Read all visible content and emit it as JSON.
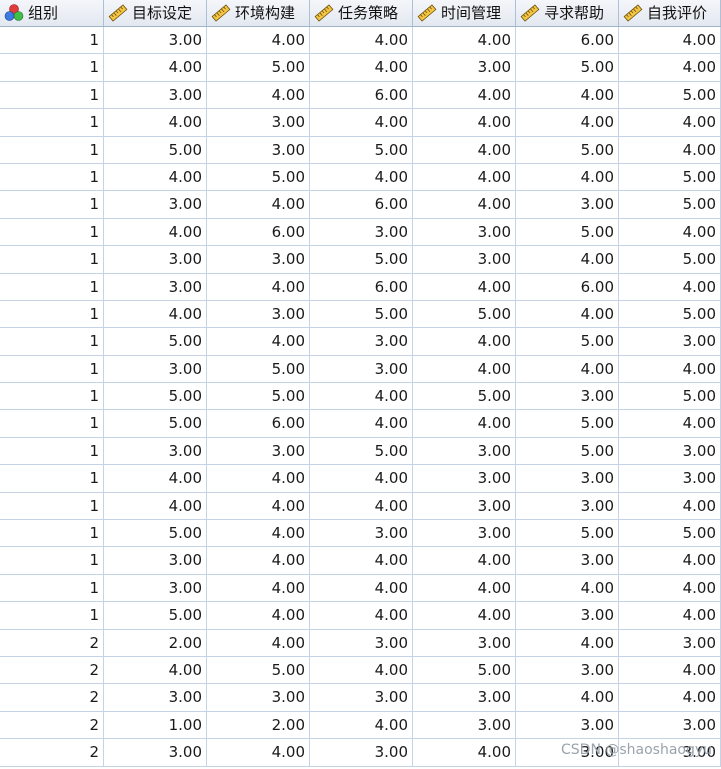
{
  "columns": [
    {
      "label": "组别",
      "icon": "nominal-icon"
    },
    {
      "label": "目标设定",
      "icon": "scale-ruler-icon"
    },
    {
      "label": "环境构建",
      "icon": "scale-ruler-icon"
    },
    {
      "label": "任务策略",
      "icon": "scale-ruler-icon"
    },
    {
      "label": "时间管理",
      "icon": "scale-ruler-icon"
    },
    {
      "label": "寻求帮助",
      "icon": "scale-ruler-icon"
    },
    {
      "label": "自我评价",
      "icon": "scale-ruler-icon"
    }
  ],
  "rows": [
    [
      "1",
      "3.00",
      "4.00",
      "4.00",
      "4.00",
      "6.00",
      "4.00"
    ],
    [
      "1",
      "4.00",
      "5.00",
      "4.00",
      "3.00",
      "5.00",
      "4.00"
    ],
    [
      "1",
      "3.00",
      "4.00",
      "6.00",
      "4.00",
      "4.00",
      "5.00"
    ],
    [
      "1",
      "4.00",
      "3.00",
      "4.00",
      "4.00",
      "4.00",
      "4.00"
    ],
    [
      "1",
      "5.00",
      "3.00",
      "5.00",
      "4.00",
      "5.00",
      "4.00"
    ],
    [
      "1",
      "4.00",
      "5.00",
      "4.00",
      "4.00",
      "4.00",
      "5.00"
    ],
    [
      "1",
      "3.00",
      "4.00",
      "6.00",
      "4.00",
      "3.00",
      "5.00"
    ],
    [
      "1",
      "4.00",
      "6.00",
      "3.00",
      "3.00",
      "5.00",
      "4.00"
    ],
    [
      "1",
      "3.00",
      "3.00",
      "5.00",
      "3.00",
      "4.00",
      "5.00"
    ],
    [
      "1",
      "3.00",
      "4.00",
      "6.00",
      "4.00",
      "6.00",
      "4.00"
    ],
    [
      "1",
      "4.00",
      "3.00",
      "5.00",
      "5.00",
      "4.00",
      "5.00"
    ],
    [
      "1",
      "5.00",
      "4.00",
      "3.00",
      "4.00",
      "5.00",
      "3.00"
    ],
    [
      "1",
      "3.00",
      "5.00",
      "3.00",
      "4.00",
      "4.00",
      "4.00"
    ],
    [
      "1",
      "5.00",
      "5.00",
      "4.00",
      "5.00",
      "3.00",
      "5.00"
    ],
    [
      "1",
      "5.00",
      "6.00",
      "4.00",
      "4.00",
      "5.00",
      "4.00"
    ],
    [
      "1",
      "3.00",
      "3.00",
      "5.00",
      "3.00",
      "5.00",
      "3.00"
    ],
    [
      "1",
      "4.00",
      "4.00",
      "4.00",
      "3.00",
      "3.00",
      "3.00"
    ],
    [
      "1",
      "4.00",
      "4.00",
      "4.00",
      "3.00",
      "3.00",
      "4.00"
    ],
    [
      "1",
      "5.00",
      "4.00",
      "3.00",
      "3.00",
      "5.00",
      "5.00"
    ],
    [
      "1",
      "3.00",
      "4.00",
      "4.00",
      "4.00",
      "3.00",
      "4.00"
    ],
    [
      "1",
      "3.00",
      "4.00",
      "4.00",
      "4.00",
      "4.00",
      "4.00"
    ],
    [
      "1",
      "5.00",
      "4.00",
      "4.00",
      "4.00",
      "3.00",
      "4.00"
    ],
    [
      "2",
      "2.00",
      "4.00",
      "3.00",
      "3.00",
      "4.00",
      "3.00"
    ],
    [
      "2",
      "4.00",
      "5.00",
      "4.00",
      "5.00",
      "3.00",
      "4.00"
    ],
    [
      "2",
      "3.00",
      "3.00",
      "3.00",
      "3.00",
      "4.00",
      "4.00"
    ],
    [
      "2",
      "1.00",
      "2.00",
      "4.00",
      "3.00",
      "3.00",
      "3.00"
    ],
    [
      "2",
      "3.00",
      "4.00",
      "3.00",
      "4.00",
      "3.00",
      "3.00"
    ]
  ],
  "watermark": "CSDN @shaoshaogyu"
}
